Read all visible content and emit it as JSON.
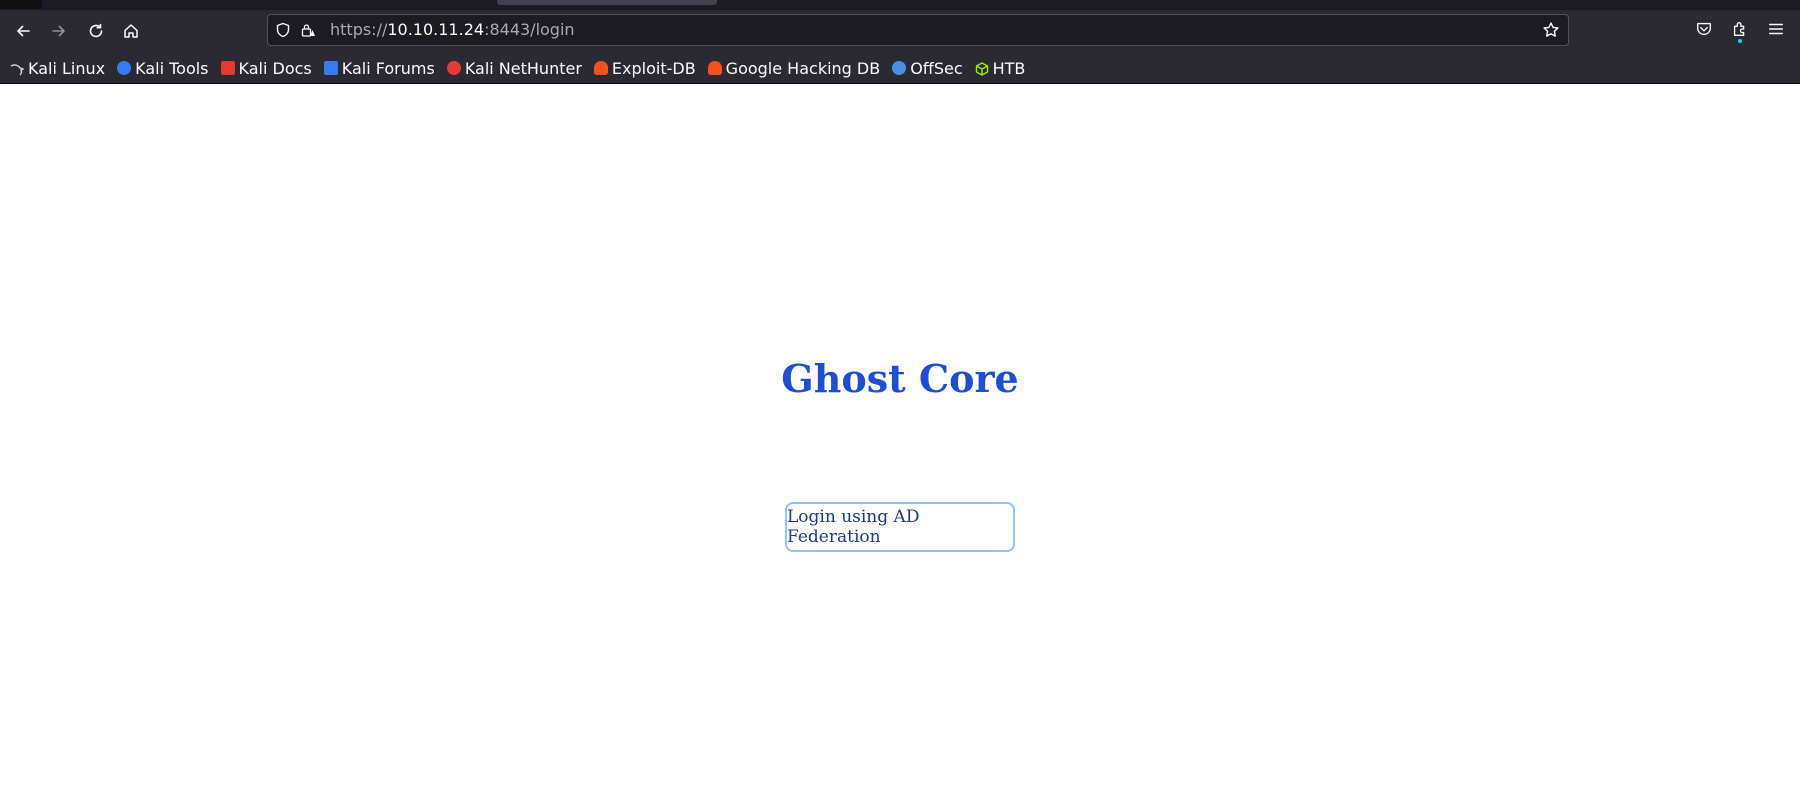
{
  "browser": {
    "url_prefix": "https://",
    "url_host": "10.10.11.24",
    "url_rest": ":8443/login",
    "icons": {
      "back": "back-arrow-icon",
      "forward": "forward-arrow-icon",
      "reload": "reload-icon",
      "home": "home-icon",
      "shield": "shield-icon",
      "lock": "lock-warning-icon",
      "star": "star-icon",
      "pocket": "pocket-icon",
      "extensions": "extensions-icon",
      "menu": "hamburger-menu-icon"
    },
    "colors": {
      "chrome_bg": "#2b2a33",
      "url_bg": "#1c1b22",
      "text": "#fbfbfe"
    }
  },
  "bookmarks": [
    {
      "label": "Kali Linux",
      "icon": "kali-dragon-icon",
      "color": "#367bf0"
    },
    {
      "label": "Kali Tools",
      "icon": "kali-tools-icon",
      "color": "#367bf0"
    },
    {
      "label": "Kali Docs",
      "icon": "kali-docs-icon",
      "color": "#e53935"
    },
    {
      "label": "Kali Forums",
      "icon": "kali-forums-icon",
      "color": "#367bf0"
    },
    {
      "label": "Kali NetHunter",
      "icon": "kali-nethunter-icon",
      "color": "#e53935"
    },
    {
      "label": "Exploit-DB",
      "icon": "exploit-db-icon",
      "color": "#f4511e"
    },
    {
      "label": "Google Hacking DB",
      "icon": "ghdb-icon",
      "color": "#f4511e"
    },
    {
      "label": "OffSec",
      "icon": "offsec-icon",
      "color": "#4a90e2"
    },
    {
      "label": "HTB",
      "icon": "htb-cube-icon",
      "color": "#9fef00"
    }
  ],
  "page": {
    "title": "Ghost Core",
    "login_button_label": "Login using AD Federation",
    "colors": {
      "title": "#1d4ed8",
      "button_border": "#93c5fd",
      "button_text": "#1e3a8a"
    }
  }
}
